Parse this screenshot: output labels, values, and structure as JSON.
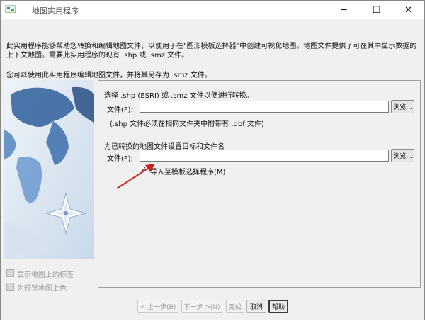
{
  "window": {
    "title": "地图实用程序"
  },
  "intro": {
    "line1": "此实用程序能够帮助您转换和编辑地图文件，以便用于在\"图形模板选择器\"中创建可视化地图。地图文件提供了可在其中显示数据的上下文地图。需要此实用程序的现有 .shp 或 .smz 文件。",
    "line2": "您可以使用此实用程序编辑地图文件，并将其另存为 .smz 文件。"
  },
  "left": {
    "show_labels": "显示地图上的标签",
    "preview_color": "为预览地图上色"
  },
  "convert": {
    "heading": "选择 .shp (ESRI) 或 .smz 文件以便进行转换。",
    "file_label": "文件(F):",
    "file_value": "",
    "browse_label": "浏览...",
    "note": "(.shp 文件必须在相同文件夹中附带有 .dbf 文件)"
  },
  "target": {
    "heading": "为已转换的地图文件设置目标和文件名",
    "file_label": "文件(F):",
    "file_value": "",
    "browse_label": "浏览...",
    "import_label": "导入至模板选择程序(M)",
    "import_checked": true
  },
  "nav": {
    "prev": "< 上一步(B)",
    "next": "下一步 >(N)",
    "finish": "完成",
    "cancel": "取消",
    "help": "帮助"
  },
  "colors": {
    "arrow": "#d42020"
  }
}
